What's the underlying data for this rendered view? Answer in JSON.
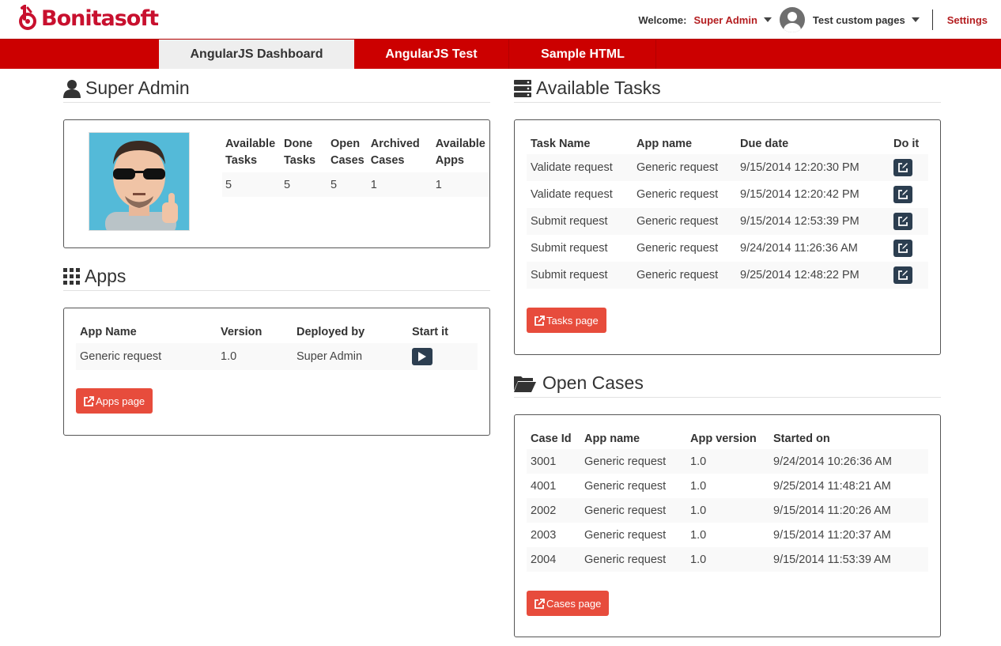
{
  "header": {
    "logo_text": "Bonitasoft",
    "welcome_label": "Welcome:",
    "user_name": "Super Admin",
    "app_selector": "Test custom pages",
    "settings_label": "Settings"
  },
  "nav": {
    "tabs": [
      {
        "label": "AngularJS Dashboard",
        "active": true
      },
      {
        "label": "AngularJS Test",
        "active": false
      },
      {
        "label": "Sample HTML",
        "active": false
      }
    ]
  },
  "profile": {
    "title": "Super Admin",
    "columns": [
      "Available Tasks",
      "Done Tasks",
      "Open Cases",
      "Archived Cases",
      "Available Apps"
    ],
    "values": [
      "5",
      "5",
      "5",
      "1",
      "1"
    ]
  },
  "apps": {
    "title": "Apps",
    "columns": [
      "App Name",
      "Version",
      "Deployed by",
      "Start it"
    ],
    "rows": [
      {
        "name": "Generic request",
        "version": "1.0",
        "deployed_by": "Super Admin"
      }
    ],
    "button_label": "Apps page"
  },
  "tasks": {
    "title": "Available Tasks",
    "columns": [
      "Task Name",
      "App name",
      "Due date",
      "Do it"
    ],
    "rows": [
      {
        "task": "Validate request",
        "app": "Generic request",
        "due": "9/15/2014 12:20:30 PM"
      },
      {
        "task": "Validate request",
        "app": "Generic request",
        "due": "9/15/2014 12:20:42 PM"
      },
      {
        "task": "Submit request",
        "app": "Generic request",
        "due": "9/15/2014 12:53:39 PM"
      },
      {
        "task": "Submit request",
        "app": "Generic request",
        "due": "9/24/2014 11:26:36 AM"
      },
      {
        "task": "Submit request",
        "app": "Generic request",
        "due": "9/25/2014 12:48:22 PM"
      }
    ],
    "button_label": "Tasks page"
  },
  "cases": {
    "title": "Open Cases",
    "columns": [
      "Case Id",
      "App name",
      "App version",
      "Started on"
    ],
    "rows": [
      {
        "id": "3001",
        "app": "Generic request",
        "version": "1.0",
        "started": "9/24/2014 10:26:36 AM"
      },
      {
        "id": "4001",
        "app": "Generic request",
        "version": "1.0",
        "started": "9/25/2014 11:48:21 AM"
      },
      {
        "id": "2002",
        "app": "Generic request",
        "version": "1.0",
        "started": "9/15/2014 11:20:26 AM"
      },
      {
        "id": "2003",
        "app": "Generic request",
        "version": "1.0",
        "started": "9/15/2014 11:20:37 AM"
      },
      {
        "id": "2004",
        "app": "Generic request",
        "version": "1.0",
        "started": "9/15/2014 11:53:39 AM"
      }
    ],
    "button_label": "Cases page"
  },
  "colors": {
    "brand": "#cc0000",
    "accent_button": "#e74c3c",
    "action_button": "#2c3e50"
  }
}
